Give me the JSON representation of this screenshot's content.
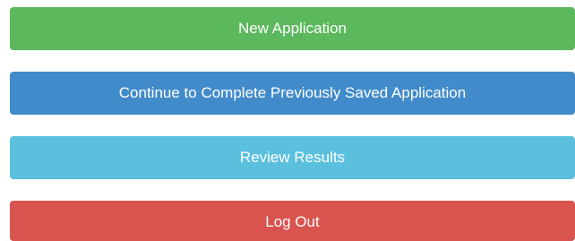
{
  "buttons": {
    "new_application": {
      "label": "New Application",
      "color": "#5cb85c"
    },
    "continue_application": {
      "label": "Continue to Complete Previously Saved Application",
      "color": "#428bca"
    },
    "review_results": {
      "label": "Review Results",
      "color": "#5bc0de"
    },
    "log_out": {
      "label": "Log Out",
      "color": "#d9534f"
    }
  }
}
